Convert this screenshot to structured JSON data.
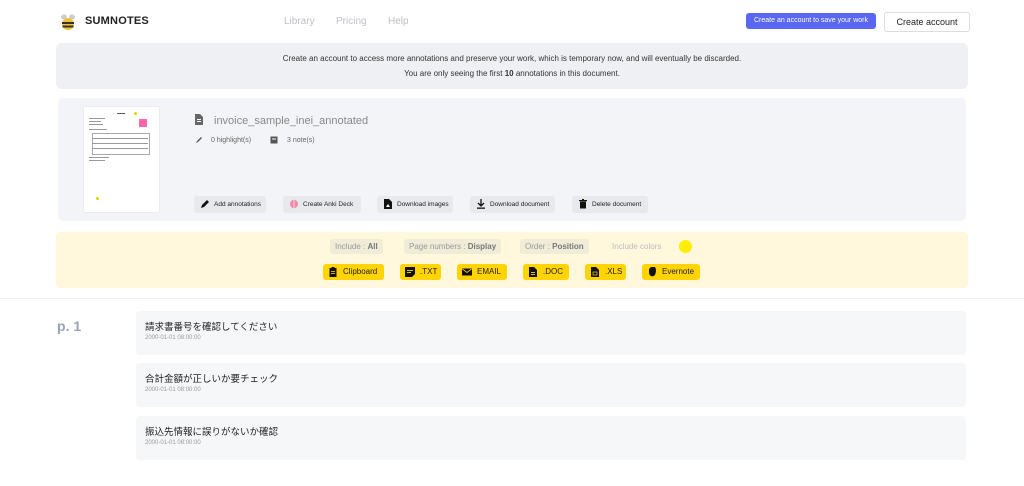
{
  "header": {
    "brand": "SUMNOTES",
    "nav": [
      "Library",
      "Pricing",
      "Help"
    ],
    "cta_hint": "Create an account to save your work",
    "create_account": "Create account"
  },
  "notice": {
    "line1": "Create an account to access more annotations and preserve your work, which is temporary now, and will eventually be discarded.",
    "line2_prefix": "You are only seeing the first ",
    "line2_count": "10",
    "line2_suffix": " annotations in this document."
  },
  "document": {
    "title": "invoice_sample_inei_annotated",
    "highlights": "0 highlight(s)",
    "notes": "3 note(s)",
    "actions": [
      "Add annotations",
      "Create Anki Deck",
      "Download images",
      "Download document",
      "Delete document"
    ]
  },
  "export": {
    "include_label": "Include : ",
    "include_value": "All",
    "page_label": "Page numbers : ",
    "page_value": "Display",
    "order_label": "Order : ",
    "order_value": "Position",
    "include_colors": "Include colors",
    "highlight_color": "#ffee00",
    "formats": [
      "Clipboard",
      ".TXT",
      "EMAIL",
      ".DOC",
      ".XLS",
      "Evernote"
    ]
  },
  "annotations": {
    "page": "p. 1",
    "items": [
      {
        "text": "請求書番号を確認してください",
        "time": "2000-01-01 08:00:00"
      },
      {
        "text": "合計金額が正しいか要チェック",
        "time": "2000-01-01 08:00:00"
      },
      {
        "text": "振込先情報に誤りがないか確認",
        "time": "2000-01-01 08:00:00"
      }
    ]
  },
  "colors": {
    "accent": "#5a67f2",
    "export_button": "#ffd400",
    "export_band": "#fff8dc"
  }
}
